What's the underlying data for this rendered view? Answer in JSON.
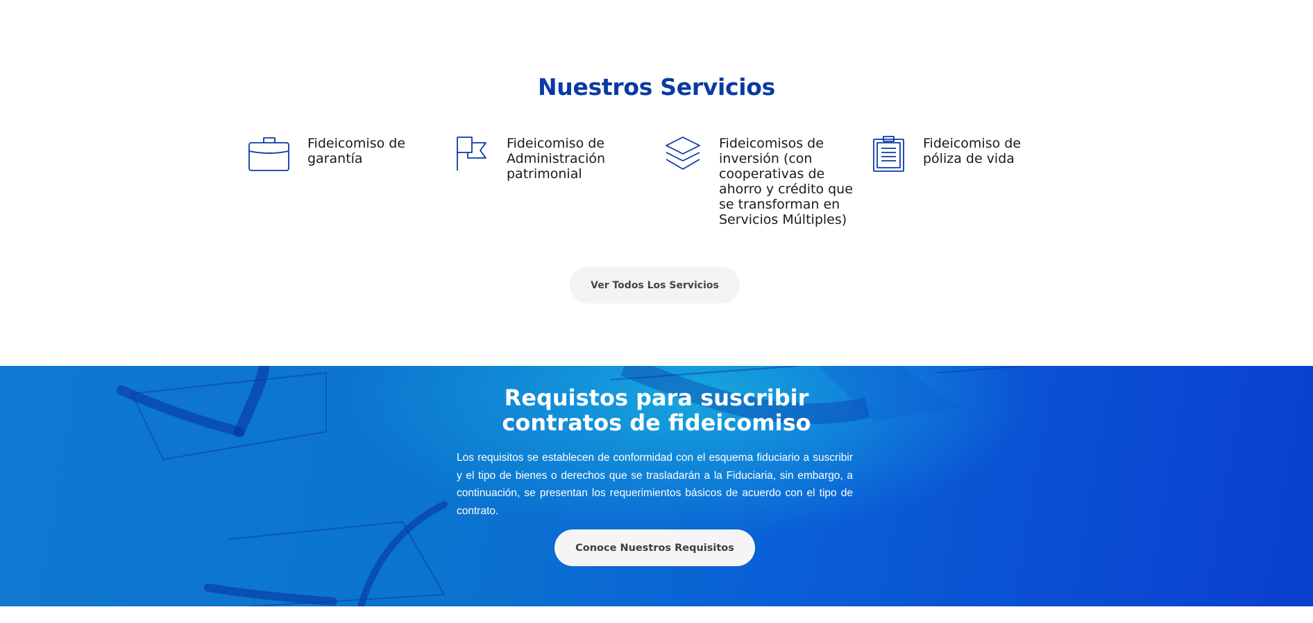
{
  "services_section": {
    "title": "Nuestros Servicios",
    "items": [
      {
        "label": "Fideicomiso de garantía",
        "icon": "briefcase-icon"
      },
      {
        "label": "Fideicomiso de Administración patrimonial",
        "icon": "flag-icon"
      },
      {
        "label": "Fideicomisos de inversión (con cooperativas de ahorro y crédito que se transforman en Servicios Múltiples)",
        "icon": "layers-icon"
      },
      {
        "label": "Fideicomiso de póliza de vida",
        "icon": "clipboard-icon"
      }
    ],
    "button_label": "Ver Todos Los Servicios"
  },
  "requirements_section": {
    "title": "Requistos para suscribir contratos de fideicomiso",
    "text": "Los requisitos se establecen de conformidad con el esquema fiduciario a suscribir y el tipo de bienes o derechos que se trasladarán a la Fiduciaria, sin embargo, a continuación, se presentan los requerimientos básicos de acuerdo con el tipo de contrato.",
    "button_label": "Conoce Nuestros Requisitos"
  },
  "colors": {
    "title_blue": "#0a3aa4",
    "icon_blue": "#0a3aa4",
    "banner_blue": "#0b6fd0",
    "button_bg": "#f3f3f3"
  }
}
